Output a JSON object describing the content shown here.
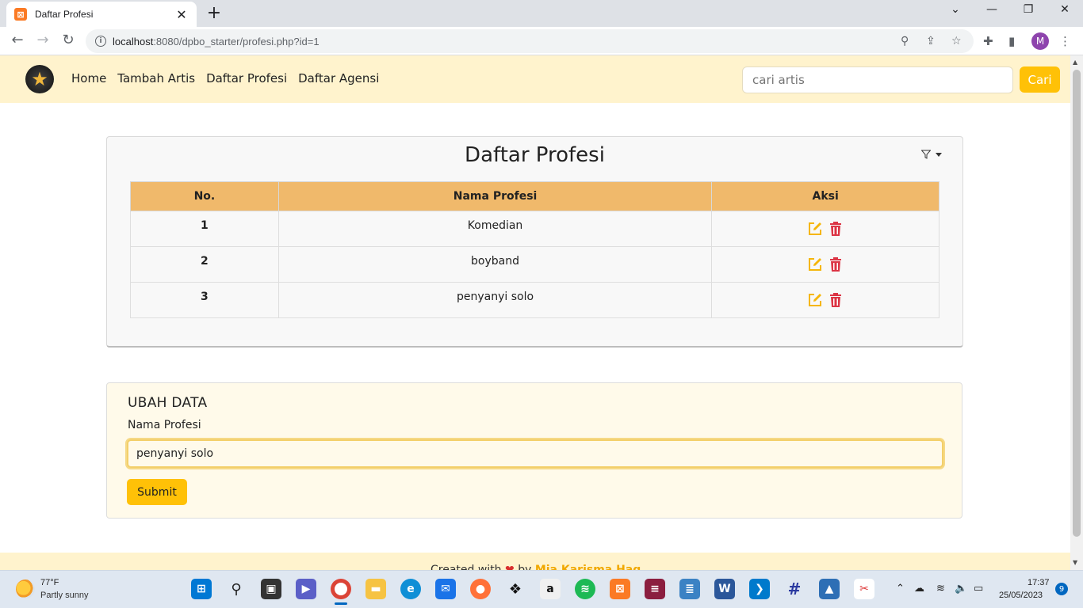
{
  "browser": {
    "tab_title": "Daftar Profesi",
    "favicon_text": "⊠",
    "tab_close": "✕",
    "new_tab": "+",
    "url_host": "localhost",
    "url_rest": ":8080/dpbo_starter/profesi.php?id=1",
    "profile_initial": "M",
    "icons": [
      "back-arrow-icon",
      "forward-arrow-icon",
      "reload-icon",
      "info-icon",
      "zoom-icon",
      "share-icon",
      "star-icon",
      "extensions-icon",
      "side-panel-icon",
      "menu-icon"
    ]
  },
  "navbar": {
    "links": [
      "Home",
      "Tambah Artis",
      "Daftar Profesi",
      "Daftar Agensi"
    ],
    "search_placeholder": "cari artis",
    "search_button": "Cari"
  },
  "list": {
    "title": "Daftar Profesi",
    "columns": [
      "No.",
      "Nama Profesi",
      "Aksi"
    ],
    "rows": [
      {
        "no": "1",
        "nama": "Komedian"
      },
      {
        "no": "2",
        "nama": "boyband"
      },
      {
        "no": "3",
        "nama": "penyanyi solo"
      }
    ],
    "colors": {
      "header": "#f0b96b",
      "edit": "#f5b60a",
      "delete": "#dc3545"
    }
  },
  "form": {
    "title": "UBAH DATA",
    "label": "Nama Profesi",
    "value": "penyanyi solo",
    "submit": "Submit"
  },
  "footer": {
    "text_before": "Created with",
    "text_by": "by",
    "author": "Mia Karisma Haq"
  },
  "taskbar": {
    "weather_temp": "77°F",
    "weather_desc": "Partly sunny",
    "time": "17:37",
    "date": "25/05/2023",
    "notification_count": "9"
  }
}
